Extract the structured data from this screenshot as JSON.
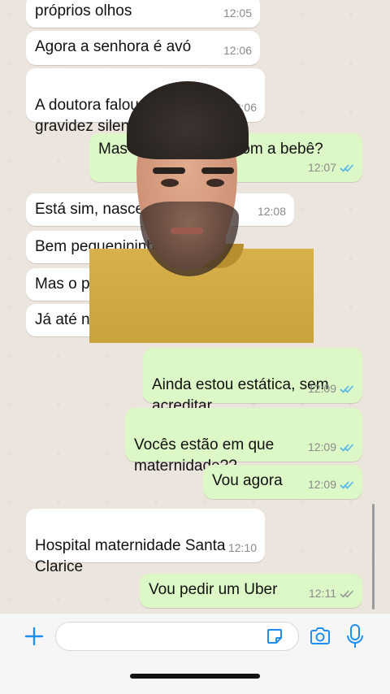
{
  "messages": [
    {
      "dir": "in",
      "text": "próprios olhos",
      "time": "12:05"
    },
    {
      "dir": "in",
      "text": "Agora a senhora é avó",
      "time": "12:06"
    },
    {
      "dir": "in",
      "text": "A doutora falou que foi uma\ngravidez silenciosa",
      "time": "12:06"
    },
    {
      "dir": "out",
      "text": "Mas está tudo bem com a bebê?",
      "time": "12:07",
      "status": "read"
    },
    {
      "dir": "in",
      "text": "Está sim, nasceu",
      "time": "12:08"
    },
    {
      "dir": "in",
      "text": "Bem pequenininha",
      "time": ""
    },
    {
      "dir": "in",
      "text": "Mas o parto",
      "time": ""
    },
    {
      "dir": "in",
      "text": "Já até nasceu",
      "time": ""
    },
    {
      "dir": "out",
      "text": "Ainda estou estática, sem\nacreditar",
      "time": "12:09",
      "status": "read"
    },
    {
      "dir": "out",
      "text": "Vocês estão em que\nmaternidade??",
      "time": "12:09",
      "status": "read"
    },
    {
      "dir": "out",
      "text": "Vou agora",
      "time": "12:09",
      "status": "read"
    },
    {
      "dir": "in",
      "text": "Hospital maternidade Santa\nClarice",
      "time": "12:10"
    },
    {
      "dir": "out",
      "text": "Vou pedir um Uber",
      "time": "12:11",
      "status": "sent"
    }
  ],
  "composer": {
    "placeholder": ""
  },
  "icons": {
    "add": "plus-icon",
    "sticker": "sticker-icon",
    "camera": "camera-icon",
    "mic": "microphone-icon",
    "read_ticks": "double-check-icon"
  },
  "colors": {
    "incoming_bubble": "#ffffff",
    "outgoing_bubble": "#dcf8c6",
    "read_ticks": "#4fb6ec",
    "sent_ticks": "#9a9a9a",
    "accent": "#1f8ef1"
  }
}
